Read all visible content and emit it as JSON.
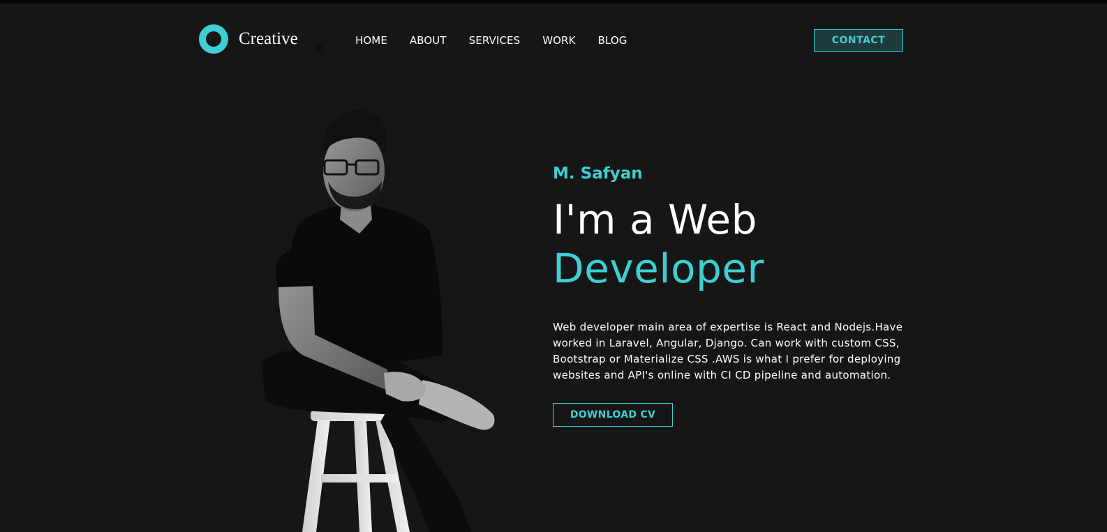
{
  "header": {
    "logo_text": "Creative",
    "nav": [
      "HOME",
      "ABOUT",
      "SERVICES",
      "WORK",
      "BLOG"
    ],
    "contact_label": "CONTACT",
    "close_icon": "×"
  },
  "hero": {
    "name": "M. Safyan",
    "headline_line1": "I'm a Web",
    "headline_line2": "Developer",
    "description": "Web developer main area of expertise is React and Nodejs.Have worked in Laravel, Angular, Django. Can work with custom CSS, Bootstrap or Materialize CSS .AWS is what I prefer for deploying websites and API's online with CI CD pipeline and automation.",
    "download_label": "DOWNLOAD CV"
  },
  "colors": {
    "background": "#161617",
    "accent": "#3ecfd3",
    "text": "#ffffff"
  },
  "icons": {
    "logo": "ring-logo-icon",
    "close": "close-icon"
  }
}
